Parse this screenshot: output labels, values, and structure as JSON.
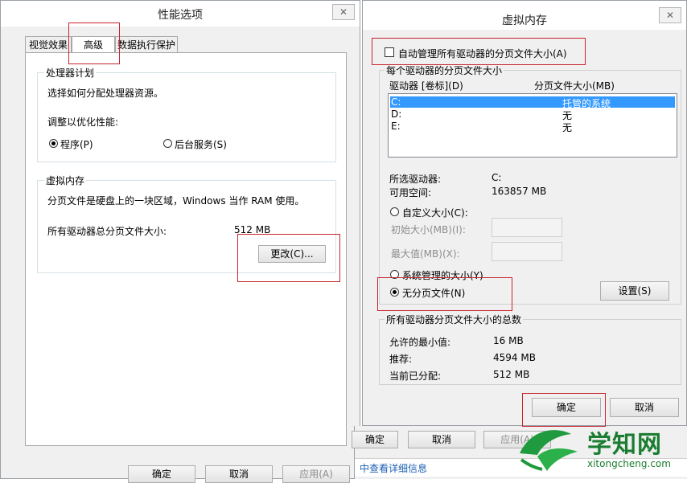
{
  "perf": {
    "title": "性能选项",
    "close": "✕",
    "tabs": [
      "视觉效果",
      "高级",
      "数据执行保护"
    ],
    "cpu_group": "处理器计划",
    "cpu_desc": "选择如何分配处理器资源。",
    "adjust_label": "调整以优化性能:",
    "opt_programs": "程序(P)",
    "opt_services": "后台服务(S)",
    "vm_group": "虚拟内存",
    "vm_desc": "分页文件是硬盘上的一块区域，Windows 当作 RAM 使用。",
    "total_label": "所有驱动器总分页文件大小:",
    "total_value": "512 MB",
    "change_btn": "更改(C)...",
    "ok": "确定",
    "cancel": "取消",
    "apply": "应用(A)"
  },
  "vm": {
    "title": "虚拟内存",
    "close": "✕",
    "auto_manage": "自动管理所有驱动器的分页文件大小(A)",
    "per_drive_group": "每个驱动器的分页文件大小",
    "col_drive": "驱动器 [卷标](D)",
    "col_size": "分页文件大小(MB)",
    "drives": [
      {
        "drive": "C:",
        "size": "托管的系统"
      },
      {
        "drive": "D:",
        "size": "无"
      },
      {
        "drive": "E:",
        "size": "无"
      }
    ],
    "selected_label": "所选驱动器:",
    "selected_value": "C:",
    "free_label": "可用空间:",
    "free_value": "163857 MB",
    "custom": "自定义大小(C):",
    "initial": "初始大小(MB)(I):",
    "maximum": "最大值(MB)(X):",
    "system_managed": "系统管理的大小(Y)",
    "no_paging": "无分页文件(N)",
    "set_btn": "设置(S)",
    "total_group": "所有驱动器分页文件大小的总数",
    "min_label": "允许的最小值:",
    "min_value": "16 MB",
    "rec_label": "推荐:",
    "rec_value": "4594 MB",
    "cur_label": "当前已分配:",
    "cur_value": "512 MB",
    "ok": "确定",
    "cancel": "取消"
  },
  "behind": {
    "ok_partial": "确定",
    "cancel": "取消",
    "apply_partial": "应用(A)",
    "link": "中查看详细信息"
  },
  "watermark": {
    "cn": "学知网",
    "url": "xitongcheng.com"
  },
  "colors": {
    "highlight": "#c8232c",
    "selection": "#3399ff"
  }
}
